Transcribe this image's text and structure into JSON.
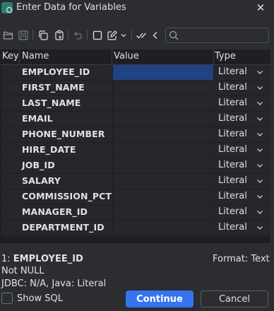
{
  "window": {
    "title": "Enter Data for Variables",
    "close_glyph": "✕"
  },
  "toolbar": {
    "search": {
      "value": "",
      "placeholder": ""
    }
  },
  "table": {
    "headers": {
      "key": "Key",
      "name": "Name",
      "value": "Value",
      "type": "Type"
    },
    "rows": [
      {
        "name": "EMPLOYEE_ID",
        "value": "",
        "type": "Literal",
        "selected": true
      },
      {
        "name": "FIRST_NAME",
        "value": "",
        "type": "Literal"
      },
      {
        "name": "LAST_NAME",
        "value": "",
        "type": "Literal"
      },
      {
        "name": "EMAIL",
        "value": "",
        "type": "Literal"
      },
      {
        "name": "PHONE_NUMBER",
        "value": "",
        "type": "Literal"
      },
      {
        "name": "HIRE_DATE",
        "value": "",
        "type": "Literal"
      },
      {
        "name": "JOB_ID",
        "value": "",
        "type": "Literal"
      },
      {
        "name": "SALARY",
        "value": "",
        "type": "Literal"
      },
      {
        "name": "COMMISSION_PCT",
        "value": "",
        "type": "Literal"
      },
      {
        "name": "MANAGER_ID",
        "value": "",
        "type": "Literal"
      },
      {
        "name": "DEPARTMENT_ID",
        "value": "",
        "type": "Literal"
      }
    ]
  },
  "status": {
    "index_prefix": "1: ",
    "selected_name": "EMPLOYEE_ID",
    "format": "Format: Text",
    "nullability": "Not NULL",
    "jdbc": "JDBC: N/A, Java: Literal"
  },
  "footer": {
    "show_sql_label": "Show SQL",
    "continue_label": "Continue",
    "cancel_label": "Cancel"
  },
  "colors": {
    "background": "#2b2d30",
    "table_background": "#1e1f22",
    "selection": "#214283",
    "primary_button": "#3574f0"
  }
}
